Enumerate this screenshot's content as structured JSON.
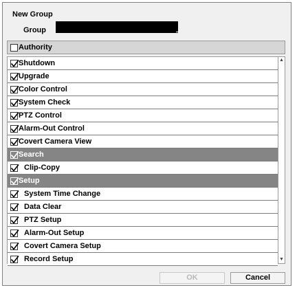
{
  "dialog": {
    "title": "New Group",
    "group_label": "Group",
    "group_value": ""
  },
  "authority": {
    "label": "Authority",
    "checked": false
  },
  "items": [
    {
      "label": "Shutdown",
      "checked": true,
      "type": "item"
    },
    {
      "label": "Upgrade",
      "checked": true,
      "type": "item"
    },
    {
      "label": "Color Control",
      "checked": true,
      "type": "item"
    },
    {
      "label": "System Check",
      "checked": true,
      "type": "item"
    },
    {
      "label": "PTZ Control",
      "checked": true,
      "type": "item"
    },
    {
      "label": "Alarm-Out Control",
      "checked": true,
      "type": "item"
    },
    {
      "label": "Covert Camera View",
      "checked": true,
      "type": "item"
    },
    {
      "label": "Search",
      "checked": true,
      "type": "header"
    },
    {
      "label": "Clip-Copy",
      "checked": true,
      "type": "sub"
    },
    {
      "label": "Setup",
      "checked": true,
      "type": "header"
    },
    {
      "label": "System Time Change",
      "checked": true,
      "type": "sub"
    },
    {
      "label": "Data Clear",
      "checked": true,
      "type": "sub"
    },
    {
      "label": "PTZ Setup",
      "checked": true,
      "type": "sub"
    },
    {
      "label": "Alarm-Out Setup",
      "checked": true,
      "type": "sub"
    },
    {
      "label": "Covert Camera Setup",
      "checked": true,
      "type": "sub"
    },
    {
      "label": "Record Setup",
      "checked": true,
      "type": "sub"
    }
  ],
  "buttons": {
    "ok": "OK",
    "cancel": "Cancel"
  },
  "colors": {
    "header_row": "#858585",
    "input_bg": "#000000"
  }
}
